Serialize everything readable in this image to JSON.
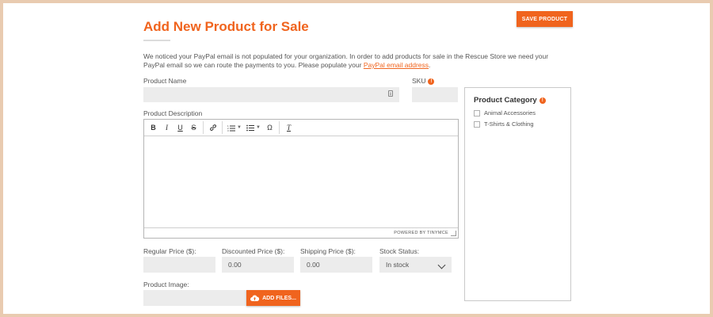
{
  "page": {
    "title": "Add New Product for Sale",
    "save_label": "SAVE PRODUCT"
  },
  "notice": {
    "text": "We noticed your PayPal email is not populated for your organization. In order to add products for sale in the Rescue Store we need your PayPal email so we can route the payments to you. Please populate your ",
    "link": "PayPal email address",
    "end": "."
  },
  "fields": {
    "product_name_label": "Product Name",
    "product_name_value": "",
    "sku_label": "SKU",
    "sku_value": "",
    "description_label": "Product Description",
    "regular_price_label": "Regular Price ($):",
    "regular_price_value": "",
    "discounted_price_label": "Discounted Price ($):",
    "discounted_price_value": "0.00",
    "shipping_price_label": "Shipping Price ($):",
    "shipping_price_value": "0.00",
    "stock_status_label": "Stock Status:",
    "stock_status_value": "In stock",
    "image_label": "Product Image:",
    "add_files_label": "ADD FILES..."
  },
  "editor": {
    "toolbar": [
      "B",
      "I",
      "U",
      "S",
      "link",
      "ordered-list",
      "bullet-list",
      "Ω",
      "clear-format"
    ],
    "status": "POWERED BY TINYMCE"
  },
  "category": {
    "title": "Product Category",
    "options": [
      "Animal Accessories",
      "T-Shirts & Clothing"
    ]
  },
  "colors": {
    "accent": "#f0641e",
    "field_bg": "#ececec",
    "frame": "#e9cbb0"
  }
}
